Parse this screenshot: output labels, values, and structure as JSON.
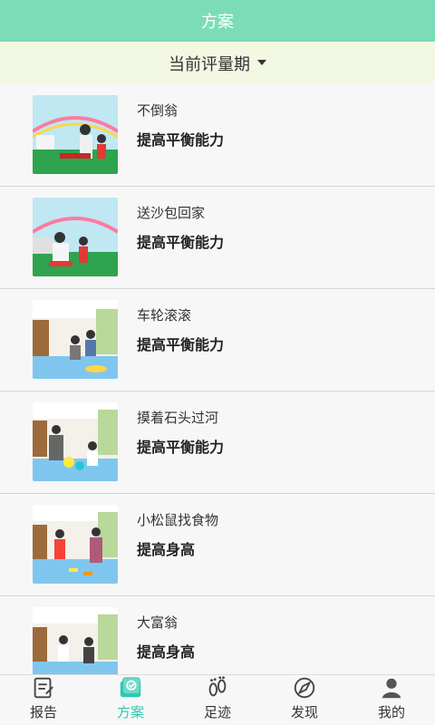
{
  "header": {
    "title": "方案"
  },
  "filter": {
    "label": "当前评量期"
  },
  "items": [
    {
      "title": "不倒翁",
      "subtitle": "提高平衡能力",
      "thumb": "banner-photo"
    },
    {
      "title": "送沙包回家",
      "subtitle": "提高平衡能力",
      "thumb": "banner-photo"
    },
    {
      "title": "车轮滚滚",
      "subtitle": "提高平衡能力",
      "thumb": "room-photo"
    },
    {
      "title": "摸着石头过河",
      "subtitle": "提高平衡能力",
      "thumb": "room-photo"
    },
    {
      "title": "小松鼠找食物",
      "subtitle": "提高身高",
      "thumb": "room-photo"
    },
    {
      "title": "大富翁",
      "subtitle": "提高身高",
      "thumb": "room-photo"
    }
  ],
  "nav": [
    {
      "label": "报告",
      "icon": "report-icon",
      "active": false
    },
    {
      "label": "方案",
      "icon": "plan-icon",
      "active": true
    },
    {
      "label": "足迹",
      "icon": "footprint-icon",
      "active": false
    },
    {
      "label": "发现",
      "icon": "discover-icon",
      "active": false
    },
    {
      "label": "我的",
      "icon": "profile-icon",
      "active": false
    }
  ],
  "colors": {
    "header": "#7ddcb8",
    "filter_bg": "#f2f8e2",
    "accent": "#2fc8b0"
  }
}
